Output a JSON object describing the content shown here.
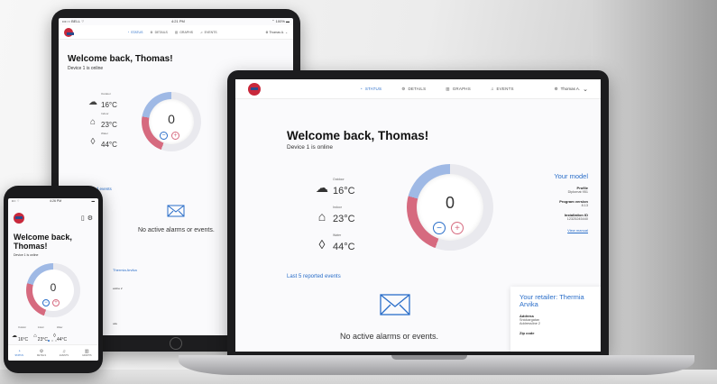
{
  "colors": {
    "accent": "#2a6ec9",
    "brand_red": "#c8283b",
    "brand_blue": "#2b4a8c",
    "dial_red": "#d66a7f",
    "dial_blue": "#9fb9e5"
  },
  "tablet": {
    "status": {
      "carrier": "•••○○ BELL ⌔",
      "time": "4:21 PM",
      "battery": "⌃ 100% ▬"
    },
    "nav": {
      "tabs": [
        {
          "label": "STATUS",
          "icon": "gauge-icon"
        },
        {
          "label": "DETAILS",
          "icon": "gear-icon"
        },
        {
          "label": "GRAPHS",
          "icon": "bar-chart-icon"
        },
        {
          "label": "EVENTS",
          "icon": "bell-icon"
        }
      ],
      "user": "Thomas A."
    },
    "welcome": "Welcome back, Thomas!",
    "online": "Device 1 is online",
    "metrics": [
      {
        "label": "Outdoor",
        "value": "16°C",
        "icon": "cloud-icon"
      },
      {
        "label": "Indoor",
        "value": "23°C",
        "icon": "house-icon"
      },
      {
        "label": "Water",
        "value": "44°C",
        "icon": "drop-icon"
      }
    ],
    "dial_value": "0",
    "last_events": "Last 5 reported events",
    "no_alarms": "No active alarms or events.",
    "retailer_fragment": "Thermia Arvika",
    "address_fragment": "estine 2",
    "zip_fragment": "ode"
  },
  "laptop": {
    "nav": {
      "tabs": [
        {
          "label": "STATUS",
          "icon": "gauge-icon"
        },
        {
          "label": "DETAILS",
          "icon": "gear-icon"
        },
        {
          "label": "GRAPHS",
          "icon": "bar-chart-icon"
        },
        {
          "label": "EVENTS",
          "icon": "bell-icon"
        }
      ],
      "user": "Thomas A."
    },
    "welcome": "Welcome back, Thomas!",
    "online": "Device 1 is online",
    "metrics": [
      {
        "label": "Outdoor",
        "value": "16°C",
        "icon": "cloud-icon"
      },
      {
        "label": "Indoor",
        "value": "23°C",
        "icon": "house-icon"
      },
      {
        "label": "Water",
        "value": "44°C",
        "icon": "drop-icon"
      }
    ],
    "dial_value": "0",
    "model": {
      "heading": "Your model",
      "profile_label": "Profile",
      "profile_value": "Diplomat 951",
      "program_label": "Program version",
      "program_value": "8.13",
      "install_label": "Installation ID",
      "install_value": "12325245440",
      "manual_link": "View manual"
    },
    "last_events": "Last 5 reported events",
    "no_alarms": "No active alarms or events.",
    "retailer": {
      "heading": "Your retailer: Thermia Arvika",
      "address_label": "Address",
      "address_line1": "Snickargatan",
      "address_line2": "Addressline 2",
      "zip_label": "Zip code"
    }
  },
  "phone": {
    "status": {
      "carrier": "••○ ⌔",
      "time": "4:26 PM",
      "battery": "▬"
    },
    "header_icons": [
      "battery-icon",
      "gear-icon"
    ],
    "welcome": "Welcome back, Thomas!",
    "online": "Device 1 is online",
    "dial_value": "0",
    "metrics": [
      {
        "label": "Outdoor",
        "value": "16°C",
        "icon": "cloud-icon"
      },
      {
        "label": "Indoor",
        "value": "23°C",
        "icon": "house-icon"
      },
      {
        "label": "Water",
        "value": "44°C",
        "icon": "drop-icon"
      }
    ],
    "tabs": [
      {
        "label": "STATUS",
        "icon": "gauge-icon"
      },
      {
        "label": "DETAILS",
        "icon": "gear-icon"
      },
      {
        "label": "EVENTS",
        "icon": "bell-icon"
      },
      {
        "label": "GRAPHS",
        "icon": "bar-chart-icon"
      }
    ]
  }
}
